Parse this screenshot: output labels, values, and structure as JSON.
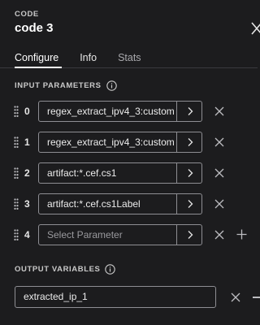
{
  "header": {
    "kicker": "CODE",
    "title": "code 3"
  },
  "tabs": [
    {
      "label": "Configure",
      "active": true
    },
    {
      "label": "Info",
      "active": false
    },
    {
      "label": "Stats",
      "active": false
    }
  ],
  "input_parameters": {
    "heading": "INPUT PARAMETERS",
    "rows": [
      {
        "index": "0",
        "value": "regex_extract_ipv4_3:custom"
      },
      {
        "index": "1",
        "value": "regex_extract_ipv4_3:custom"
      },
      {
        "index": "2",
        "value": "artifact:*.cef.cs1"
      },
      {
        "index": "3",
        "value": "artifact:*.cef.cs1Label"
      },
      {
        "index": "4",
        "value": "",
        "placeholder": "Select Parameter"
      }
    ]
  },
  "output_variables": {
    "heading": "OUTPUT VARIABLES",
    "value": "extracted_ip_1"
  },
  "colors": {
    "background": "#1c1c1e",
    "border": "#8e8e93",
    "text": "#e6e6e6",
    "muted": "#a9a9ad"
  },
  "icons": [
    "drag-handle-icon",
    "chevron-right-icon",
    "close-icon",
    "plus-icon",
    "minus-icon",
    "info-icon"
  ]
}
